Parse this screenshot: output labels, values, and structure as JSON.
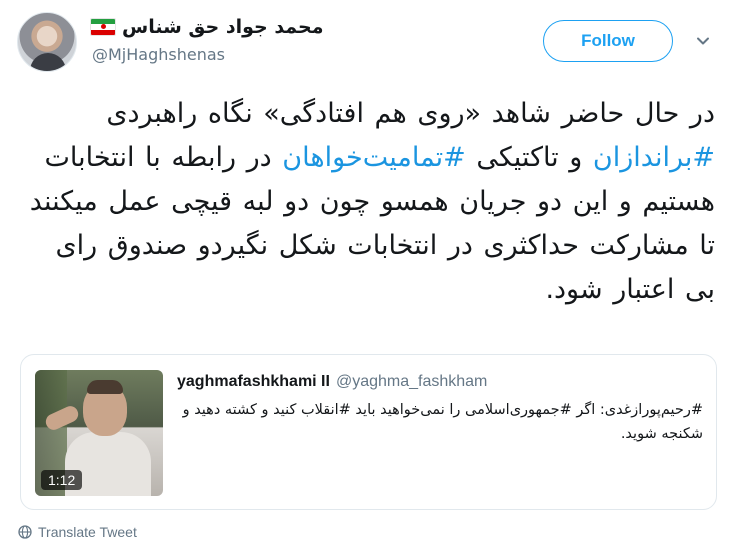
{
  "author": {
    "display_name": "محمد جواد حق شناس",
    "handle": "@MjHaghshenas",
    "flag_icon": "iran-flag-icon"
  },
  "header": {
    "follow_label": "Follow",
    "menu_icon": "chevron-down-icon"
  },
  "tweet": {
    "segments": [
      {
        "text": "در حال حاضر شاهد «روی هم افتادگی» نگاه راهبردی ",
        "hashtag": false
      },
      {
        "text": "#براندازان",
        "hashtag": true
      },
      {
        "text": " و تاکتیکی ",
        "hashtag": false
      },
      {
        "text": "#تمامیت‌خواهان",
        "hashtag": true
      },
      {
        "text": " در رابطه با انتخابات هستیم و این دو جریان همسو چون دو لبه قیچی عمل میکنند تا مشارکت حداکثری در انتخابات شکل نگیردو صندوق رای بی اعتبار شود.",
        "hashtag": false
      }
    ]
  },
  "quoted": {
    "name": "yaghmafashkhami II",
    "handle": "@yaghma_fashkham",
    "text": "#رحیم‌پورازغدی: اگر #جمهوری‌اسلامی را نمی‌خواهید باید #انقلاب کنید و کشته دهید و شکنجه شوید.",
    "video_duration": "1:12"
  },
  "footer": {
    "translate_label": "Translate Tweet",
    "translate_icon": "globe-icon"
  },
  "colors": {
    "accent": "#1da1f2",
    "hashtag": "#1b95e0",
    "secondary_text": "#657786",
    "border": "#e1e8ed"
  }
}
